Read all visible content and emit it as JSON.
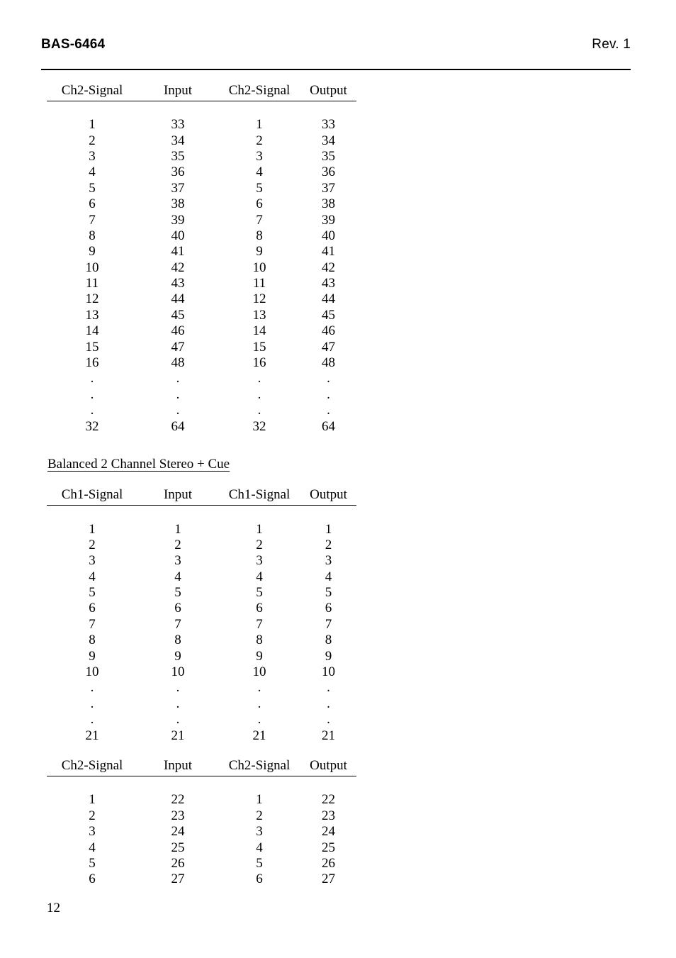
{
  "header": {
    "model": "BAS-6464",
    "revision": "Rev. 1"
  },
  "footer": {
    "page_number": "12"
  },
  "headings": {
    "balanced_stereo_cue": "Balanced 2 Channel Stereo + Cue"
  },
  "tables": [
    {
      "id": "table-ch2-64",
      "columns": [
        "Ch2-Signal",
        "Input",
        "Ch2-Signal",
        "Output"
      ],
      "rows": [
        [
          "1",
          "33",
          "1",
          "33"
        ],
        [
          "2",
          "34",
          "2",
          "34"
        ],
        [
          "3",
          "35",
          "3",
          "35"
        ],
        [
          "4",
          "36",
          "4",
          "36"
        ],
        [
          "5",
          "37",
          "5",
          "37"
        ],
        [
          "6",
          "38",
          "6",
          "38"
        ],
        [
          "7",
          "39",
          "7",
          "39"
        ],
        [
          "8",
          "40",
          "8",
          "40"
        ],
        [
          "9",
          "41",
          "9",
          "41"
        ],
        [
          "10",
          "42",
          "10",
          "42"
        ],
        [
          "11",
          "43",
          "11",
          "43"
        ],
        [
          "12",
          "44",
          "12",
          "44"
        ],
        [
          "13",
          "45",
          "13",
          "45"
        ],
        [
          "14",
          "46",
          "14",
          "46"
        ],
        [
          "15",
          "47",
          "15",
          "47"
        ],
        [
          "16",
          "48",
          "16",
          "48"
        ],
        [
          ".",
          ".",
          ".",
          "."
        ],
        [
          ".",
          ".",
          ".",
          "."
        ],
        [
          ".",
          ".",
          ".",
          "."
        ],
        [
          "32",
          "64",
          "32",
          "64"
        ]
      ]
    },
    {
      "id": "table-ch1-21",
      "columns": [
        "Ch1-Signal",
        "Input",
        "Ch1-Signal",
        "Output"
      ],
      "rows": [
        [
          "1",
          "1",
          "1",
          "1"
        ],
        [
          "2",
          "2",
          "2",
          "2"
        ],
        [
          "3",
          "3",
          "3",
          "3"
        ],
        [
          "4",
          "4",
          "4",
          "4"
        ],
        [
          "5",
          "5",
          "5",
          "5"
        ],
        [
          "6",
          "6",
          "6",
          "6"
        ],
        [
          "7",
          "7",
          "7",
          "7"
        ],
        [
          "8",
          "8",
          "8",
          "8"
        ],
        [
          "9",
          "9",
          "9",
          "9"
        ],
        [
          "10",
          "10",
          "10",
          "10"
        ],
        [
          ".",
          ".",
          ".",
          "."
        ],
        [
          ".",
          ".",
          ".",
          "."
        ],
        [
          ".",
          ".",
          ".",
          "."
        ],
        [
          "21",
          "21",
          "21",
          "21"
        ]
      ]
    },
    {
      "id": "table-ch2-27",
      "columns": [
        "Ch2-Signal",
        "Input",
        "Ch2-Signal",
        "Output"
      ],
      "rows": [
        [
          "1",
          "22",
          "1",
          "22"
        ],
        [
          "2",
          "23",
          "2",
          "23"
        ],
        [
          "3",
          "24",
          "3",
          "24"
        ],
        [
          "4",
          "25",
          "4",
          "25"
        ],
        [
          "5",
          "26",
          "5",
          "26"
        ],
        [
          "6",
          "27",
          "6",
          "27"
        ]
      ]
    }
  ]
}
